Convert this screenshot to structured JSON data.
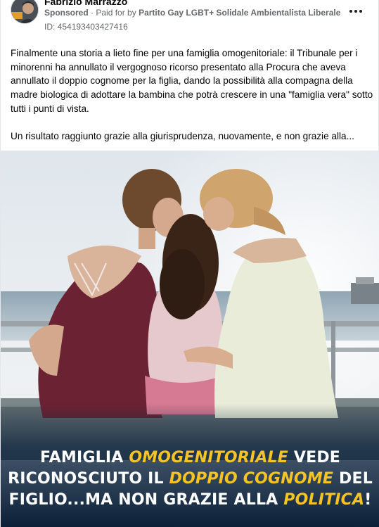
{
  "post": {
    "author": "Fabrizio Marrazzo",
    "sponsored_label": "Sponsored",
    "separator": "·",
    "paid_for_prefix": "Paid for by",
    "advertiser": "Partito Gay LGBT+ Solidale Ambientalista Liberale",
    "ad_id": "ID: 454193403427416",
    "caption_paragraph_1": "Finalmente una storia a lieto fine per una famiglia omogenitoriale: il Tribunale per i minorenni ha annullato il vergognoso ricorso presentato alla Procura che aveva annullato il doppio cognome per la figlia, dando la possibilità alla compagna della madre biologica di adottare la bambina che potrà crescere in una \"famiglia vera\" sotto tutti i punti di vista.",
    "caption_paragraph_2": "Un risultato raggiunto grazie alla giurisprudenza, nuovamente, e non grazie alla..."
  },
  "image": {
    "headline_line1_a": "FAMIGLIA ",
    "headline_line1_b": "OMOGENITORIALE",
    "headline_line1_c": " VEDE",
    "headline_line2_a": "RICONOSCIUTO IL ",
    "headline_line2_b": "DOPPIO COGNOME",
    "headline_line2_c": " DEL",
    "headline_line3_a": "FIGLIO...MA NON GRAZIE ALLA ",
    "headline_line3_b": "POLITICA",
    "headline_line3_c": "!"
  },
  "icons": {
    "more": "more-horizontal-icon",
    "avatar": "profile-photo"
  },
  "colors": {
    "highlight": "#f6c324",
    "meta_text": "#65676b",
    "overlay": "#0f2741"
  }
}
